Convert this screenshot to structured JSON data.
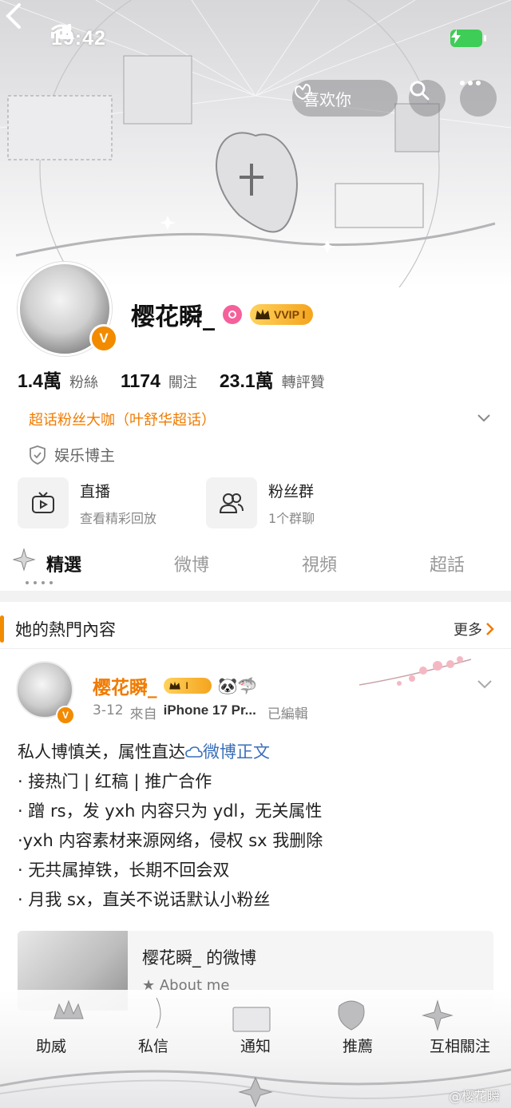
{
  "status_bar": {
    "time": "19:42"
  },
  "header": {
    "like_label": "喜欢你"
  },
  "profile": {
    "name": "樱花瞬_",
    "v_badge": "V",
    "vip_label": "VVIP I",
    "stats": [
      {
        "num": "1.4",
        "unit": "萬",
        "label": "粉絲"
      },
      {
        "num": "1174",
        "unit": "",
        "label": "關注"
      },
      {
        "num": "23.1",
        "unit": "萬",
        "label": "轉評贊"
      }
    ],
    "supertag": "超话粉丝大咖（叶舒华超话）",
    "certification": "娱乐博主"
  },
  "cards": [
    {
      "title": "直播",
      "subtitle": "查看精彩回放",
      "icon": "tv-icon"
    },
    {
      "title": "粉丝群",
      "subtitle": "1个群聊",
      "icon": "group-icon"
    }
  ],
  "tabs": [
    {
      "label": "精選",
      "active": true
    },
    {
      "label": "微博",
      "active": false
    },
    {
      "label": "視頻",
      "active": false
    },
    {
      "label": "超話",
      "active": false
    }
  ],
  "hot_section": {
    "title": "她的熱門內容",
    "more": "更多"
  },
  "post": {
    "author": "樱花瞬_",
    "vip_level": "I",
    "emojis": "🐼🦈",
    "date": "3-12",
    "from_label": "來自",
    "device": "iPhone 17 Pr...",
    "edited": "已編輯",
    "lines": [
      {
        "text": "私人博慎关，属性直达",
        "link": "微博正文"
      },
      {
        "text": "· 接热门 | 红稿 | 推广合作",
        "link": ""
      },
      {
        "text": "· 蹭 rs，发 yxh 内容只为 ydl，无关属性",
        "link": ""
      },
      {
        "text": "·yxh 内容素材来源网络，侵权 sx 我删除",
        "link": ""
      },
      {
        "text": "· 无共属掉铁，长期不回会双",
        "link": ""
      },
      {
        "text": "· 月我 sx，直关不说话默认小粉丝",
        "link": ""
      }
    ],
    "share_title": "樱花瞬_ 的微博",
    "share_sub": "About me"
  },
  "bottom_nav": [
    "助威",
    "私信",
    "通知",
    "推薦",
    "互相關注"
  ],
  "watermark": "@樱花瞬",
  "colors": {
    "accent": "#f28b00",
    "link": "#3a6fb8",
    "vip_gold": "#f4a41e"
  }
}
